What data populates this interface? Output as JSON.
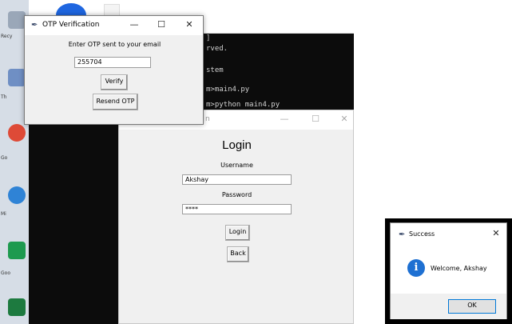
{
  "desktop": {
    "icons": [
      {
        "label": "Recy",
        "color": "#9aa7b8"
      },
      {
        "label": "Th",
        "color": "#6f8fc4"
      },
      {
        "label": "Go",
        "color": "#de4a37"
      },
      {
        "label": "Mi",
        "color": "#2f83d6"
      },
      {
        "label": "Goo",
        "color": "#1e9a4f"
      },
      {
        "label": "",
        "color": "#1d7a3f"
      }
    ]
  },
  "console": {
    "lines": [
      "]",
      "rved.",
      "stem",
      "m>main4.py",
      "m>python main4.py"
    ]
  },
  "otp_window": {
    "title": "OTP Verification",
    "minimize": "—",
    "maximize": "☐",
    "close": "✕",
    "prompt": "Enter OTP sent to your email",
    "otp_value": "255704",
    "verify_label": "Verify",
    "resend_label": "Resend OTP"
  },
  "login_window": {
    "title_fragment": "n",
    "minimize": "—",
    "maximize": "☐",
    "close": "✕",
    "heading": "Login",
    "username_label": "Username",
    "username_value": "Akshay",
    "password_label": "Password",
    "password_value": "****",
    "login_label": "Login",
    "back_label": "Back"
  },
  "success_dialog": {
    "title": "Success",
    "close": "✕",
    "icon_glyph": "i",
    "message": "Welcome, Akshay",
    "ok_label": "OK"
  }
}
